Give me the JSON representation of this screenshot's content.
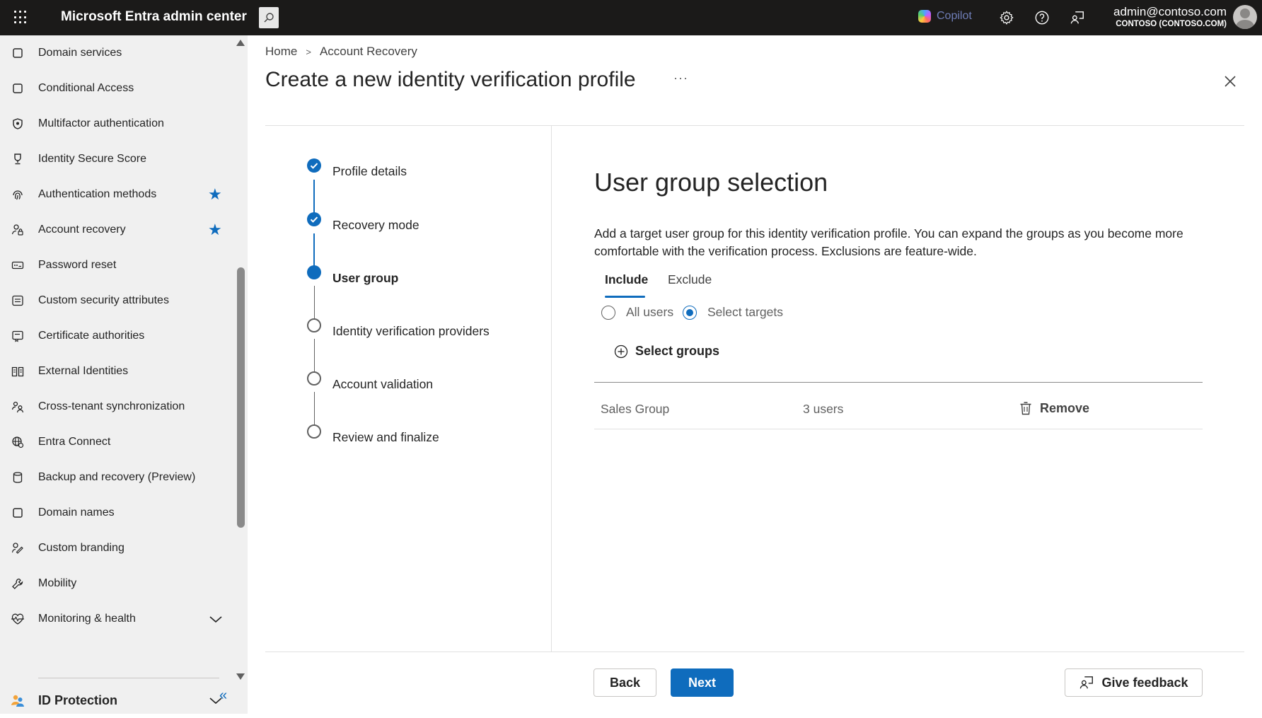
{
  "topbar": {
    "app_title": "Microsoft Entra admin center",
    "copilot_label": "Copilot",
    "account_email": "admin@contoso.com",
    "account_tenant": "CONTOSO (CONTOSO.COM)"
  },
  "sidebar": {
    "items": [
      {
        "label": "Domain services",
        "icon": "square-icon"
      },
      {
        "label": "Conditional Access",
        "icon": "square-icon"
      },
      {
        "label": "Multifactor authentication",
        "icon": "shield-icon"
      },
      {
        "label": "Identity Secure Score",
        "icon": "trophy-icon"
      },
      {
        "label": "Authentication methods",
        "icon": "fingerprint-icon",
        "favorite": true
      },
      {
        "label": "Account recovery",
        "icon": "person-lock-icon",
        "favorite": true
      },
      {
        "label": "Password reset",
        "icon": "password-icon"
      },
      {
        "label": "Custom security attributes",
        "icon": "list-icon"
      },
      {
        "label": "Certificate authorities",
        "icon": "certificate-icon"
      },
      {
        "label": "External Identities",
        "icon": "book-icon"
      },
      {
        "label": "Cross-tenant synchronization",
        "icon": "people-sync-icon"
      },
      {
        "label": "Entra Connect",
        "icon": "globe-sync-icon"
      },
      {
        "label": "Backup and recovery (Preview)",
        "icon": "database-icon"
      },
      {
        "label": "Domain names",
        "icon": "square-icon"
      },
      {
        "label": "Custom branding",
        "icon": "brush-icon"
      },
      {
        "label": "Mobility",
        "icon": "wrench-icon"
      },
      {
        "label": "Monitoring & health",
        "icon": "heart-pulse-icon"
      }
    ],
    "section": {
      "label": "ID Protection",
      "icon": "people-icon"
    },
    "collapse_label": "«"
  },
  "breadcrumb": [
    "Home",
    "Account Recovery"
  ],
  "page": {
    "title": "Create a new identity verification profile",
    "more": "···"
  },
  "steps": [
    {
      "label": "Profile details",
      "state": "done"
    },
    {
      "label": "Recovery mode",
      "state": "done"
    },
    {
      "label": "User group",
      "state": "current"
    },
    {
      "label": "Identity verification providers",
      "state": "todo"
    },
    {
      "label": "Account validation",
      "state": "todo"
    },
    {
      "label": "Review and finalize",
      "state": "todo"
    }
  ],
  "content": {
    "title": "User group selection",
    "description": "Add a target user group for this identity verification profile. You can expand the groups as you become more comfortable with the verification process. Exclusions are feature-wide.",
    "tabs": [
      "Include",
      "Exclude"
    ],
    "radio_options": [
      "All users",
      "Select targets"
    ],
    "selected_radio": "Select targets",
    "select_groups_label": "Select groups",
    "groups": [
      {
        "name": "Sales Group",
        "count": "3 users",
        "action": "Remove"
      }
    ]
  },
  "footer": {
    "back_label": "Back",
    "next_label": "Next",
    "feedback_label": "Give feedback"
  },
  "colors": {
    "accent": "#0f6cbd",
    "topbar": "#1b1a19",
    "sidebar": "#f0f0f0"
  }
}
